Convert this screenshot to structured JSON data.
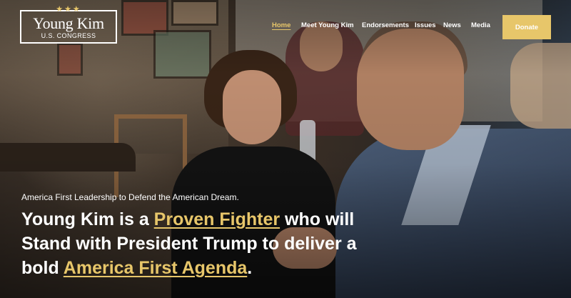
{
  "logo": {
    "stars": "★★★",
    "name": "Young Kim",
    "subtitle": "U.S. CONGRESS"
  },
  "nav": {
    "items": [
      {
        "label": "Home",
        "active": true
      },
      {
        "label": "Meet Young Kim"
      },
      {
        "label": "Endorsements"
      },
      {
        "label": "Issues"
      },
      {
        "label": "News"
      },
      {
        "label": "Media"
      }
    ],
    "donate_label": "Donate"
  },
  "hero": {
    "kicker": "America First Leadership to Defend the American Dream.",
    "headline": {
      "part1": "Young Kim is a ",
      "highlight1": "Proven Fighter",
      "part2": " who will Stand with President Trump to deliver a bold ",
      "highlight2": "America First Agenda",
      "part3": "."
    }
  },
  "colors": {
    "accent": "#e7c66a",
    "text": "#ffffff"
  }
}
